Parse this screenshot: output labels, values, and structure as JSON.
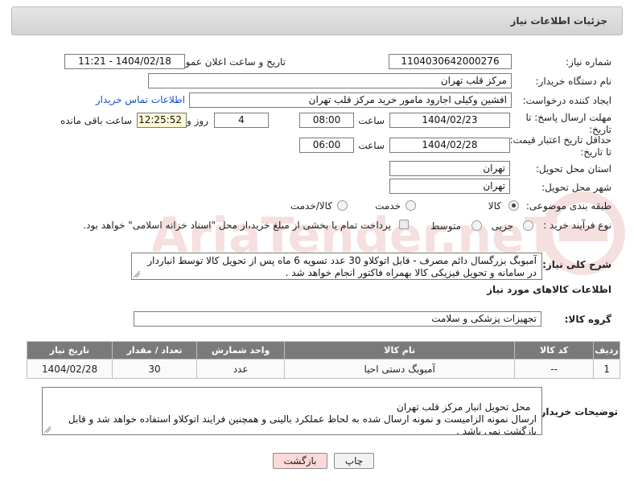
{
  "header": {
    "title": "جزئیات اطلاعات نیاز"
  },
  "form": {
    "need_number_label": "شماره نیاز:",
    "need_number": "1104030642000276",
    "announce_label": "تاریخ و ساعت اعلان عمومی:",
    "announce_value": "1404/02/18 - 11:21",
    "buyer_label": "نام دستگاه خریدار:",
    "buyer_value": "مرکز قلب تهران",
    "creator_label": "ایجاد کننده درخواست:",
    "creator_value": "افشین وکیلی اجارود مامور خرید مرکز قلب تهران",
    "contact_link": "اطلاعات تماس خریدار",
    "deadline_label": "مهلت ارسال پاسخ: تا تاریخ:",
    "deadline_date": "1404/02/23",
    "time_label": "ساعت",
    "deadline_time": "08:00",
    "days_value": "4",
    "days_label": "روز و",
    "remaining_time": "12:25:52",
    "remaining_label": "ساعت باقی مانده",
    "validity_label": "حداقل تاریخ اعتبار قیمت: تا تاریخ:",
    "validity_date": "1404/02/28",
    "validity_time": "06:00",
    "province_label": "استان محل تحویل:",
    "province_value": "تهران",
    "city_label": "شهر محل تحویل:",
    "city_value": "تهران",
    "category_label": "طبقه بندی موضوعی:",
    "category_options": [
      "کالا",
      "خدمت",
      "کالا/خدمت"
    ],
    "process_label": "نوع فرآیند خرید :",
    "process_options": [
      "جزیی",
      "متوسط"
    ],
    "payment_note": "پرداخت تمام یا بخشی از مبلغ خرید،از محل \"اسناد خزانه اسلامی\" خواهد بود.",
    "description_label": "شرح کلی نیاز:",
    "description_value": "آمبوبگ بزرگسال دائم مصرف - قابل اتوکلاو 30 عدد تسویه 6 ماه پس از تحویل کالا توسط انباردار در سامانه و تحویل فیزیکی کالا بهمراه فاکتور انجام خواهد شد ."
  },
  "goods_section": {
    "title": "اطلاعات کالاهای مورد نیاز",
    "group_label": "گروه کالا:",
    "group_value": "تجهیزات پزشکی و سلامت"
  },
  "table": {
    "headers": [
      "ردیف",
      "کد کالا",
      "نام کالا",
      "واحد شمارش",
      "تعداد / مقدار",
      "تاریخ نیاز"
    ],
    "rows": [
      [
        "1",
        "--",
        "آمبوبگ دستی احیا",
        "عدد",
        "30",
        "1404/02/28"
      ]
    ]
  },
  "buyer_notes": {
    "label": "توضیحات خریدار:",
    "value": "محل تحویل انبار مرکز قلب تهران\nارسال نمونه الزامیست و نمونه ارسال شده به لحاظ عملکرد بالینی و همچنین فرایند اتوکلاو استفاده خواهد شد و قابل بازگشت نمی باشد ."
  },
  "buttons": {
    "print": "چاپ",
    "back": "بازگشت"
  },
  "colors": {
    "table_header": "#7a7a7a",
    "back_button": "#ffd9d9",
    "link": "#1a4fd1",
    "remaining_bg": "#fffbd6"
  }
}
